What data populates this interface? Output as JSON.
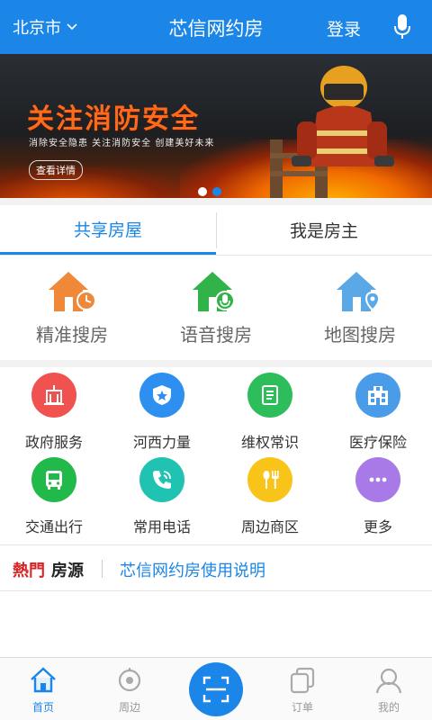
{
  "header": {
    "city": "北京市",
    "title": "芯信网约房",
    "login": "登录"
  },
  "banner": {
    "headline": "关注消防安全",
    "subline": "消除安全隐患 关注消防安全 创建美好未来",
    "button": "查看详情",
    "page_count": 2,
    "active_index": 1
  },
  "tabs": [
    {
      "label": "共享房屋",
      "active": true
    },
    {
      "label": "我是房主",
      "active": false
    }
  ],
  "search_options": [
    {
      "label": "精准搜房",
      "icon": "house-clock-icon",
      "color": "#f0883a"
    },
    {
      "label": "语音搜房",
      "icon": "house-mic-icon",
      "color": "#31b34a"
    },
    {
      "label": "地图搜房",
      "icon": "house-location-icon",
      "color": "#5aa9e6"
    }
  ],
  "services": [
    {
      "label": "政府服务",
      "icon": "government-building-icon",
      "color": "#f0524f"
    },
    {
      "label": "河西力量",
      "icon": "police-badge-icon",
      "color": "#2d8ff0"
    },
    {
      "label": "维权常识",
      "icon": "document-icon",
      "color": "#2dbd5a"
    },
    {
      "label": "医疗保险",
      "icon": "hospital-icon",
      "color": "#4a9be8"
    },
    {
      "label": "交通出行",
      "icon": "bus-icon",
      "color": "#21b94a"
    },
    {
      "label": "常用电话",
      "icon": "phone-icon",
      "color": "#20c2b1"
    },
    {
      "label": "周边商区",
      "icon": "fork-knife-icon",
      "color": "#f9c419"
    },
    {
      "label": "更多",
      "icon": "more-icon",
      "color": "#a87ae8"
    }
  ],
  "hot": {
    "tag_red": "熱門",
    "tag_black": "房源",
    "link": "芯信网约房使用说明"
  },
  "bottom_nav": [
    {
      "label": "首页",
      "icon": "home-icon",
      "active": true
    },
    {
      "label": "周边",
      "icon": "nearby-icon",
      "active": false
    },
    {
      "label": "",
      "icon": "scan-icon",
      "active": false
    },
    {
      "label": "订单",
      "icon": "orders-icon",
      "active": false
    },
    {
      "label": "我的",
      "icon": "profile-icon",
      "active": false
    }
  ],
  "colors": {
    "brand": "#1b86e8",
    "hot_red": "#d92222"
  }
}
